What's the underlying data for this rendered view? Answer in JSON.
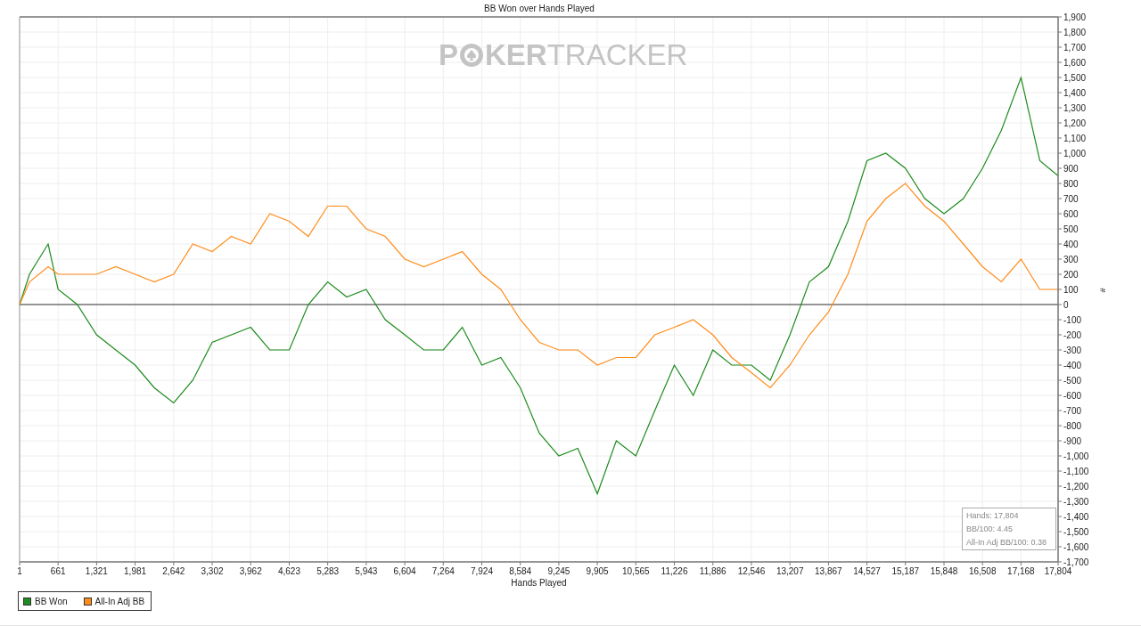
{
  "logo": {
    "before_chip": "P",
    "after_chip": "KER",
    "second_word": "TRACKER"
  },
  "chart_data": {
    "type": "line",
    "title": "BB Won over Hands Played",
    "xlabel": "Hands Played",
    "ylabel": "#",
    "x": [
      1,
      170,
      490,
      661,
      990,
      1321,
      1650,
      1981,
      2310,
      2642,
      2970,
      3302,
      3630,
      3962,
      4290,
      4623,
      4950,
      5283,
      5610,
      5943,
      6270,
      6604,
      6930,
      7264,
      7590,
      7924,
      8250,
      8584,
      8910,
      9245,
      9570,
      9905,
      10230,
      10565,
      10890,
      11226,
      11550,
      11886,
      12210,
      12546,
      12870,
      13207,
      13540,
      13867,
      14200,
      14527,
      14850,
      15187,
      15520,
      15848,
      16180,
      16508,
      16830,
      17168,
      17490,
      17804
    ],
    "series": [
      {
        "name": "BB Won",
        "color": "#1e8c1e",
        "values": [
          0,
          200,
          400,
          100,
          0,
          -200,
          -300,
          -400,
          -550,
          -650,
          -500,
          -250,
          -200,
          -150,
          -300,
          -300,
          0,
          150,
          50,
          100,
          -100,
          -200,
          -300,
          -300,
          -150,
          -400,
          -350,
          -550,
          -850,
          -1000,
          -950,
          -1250,
          -900,
          -1000,
          -700,
          -400,
          -600,
          -300,
          -400,
          -400,
          -500,
          -200,
          150,
          250,
          550,
          950,
          1000,
          900,
          700,
          600,
          700,
          900,
          1150,
          1500,
          950,
          850
        ]
      },
      {
        "name": "All-In Adj BB",
        "color": "#ff8c1a",
        "values": [
          0,
          150,
          250,
          200,
          200,
          200,
          250,
          200,
          150,
          200,
          400,
          350,
          450,
          400,
          600,
          550,
          450,
          650,
          650,
          500,
          450,
          300,
          250,
          300,
          350,
          200,
          100,
          -100,
          -250,
          -300,
          -300,
          -400,
          -350,
          -350,
          -200,
          -150,
          -100,
          -200,
          -350,
          -450,
          -550,
          -400,
          -200,
          -50,
          200,
          550,
          700,
          800,
          650,
          550,
          400,
          250,
          150,
          300,
          100,
          100
        ]
      }
    ],
    "grid": true,
    "xlim": [
      1,
      17804
    ],
    "ylim": [
      -1700,
      1900
    ],
    "xticks": [
      {
        "value": 1,
        "label": "1"
      },
      {
        "value": 661,
        "label": "661"
      },
      {
        "value": 1321,
        "label": "1,321"
      },
      {
        "value": 1981,
        "label": "1,981"
      },
      {
        "value": 2642,
        "label": "2,642"
      },
      {
        "value": 3302,
        "label": "3,302"
      },
      {
        "value": 3962,
        "label": "3,962"
      },
      {
        "value": 4623,
        "label": "4,623"
      },
      {
        "value": 5283,
        "label": "5,283"
      },
      {
        "value": 5943,
        "label": "5,943"
      },
      {
        "value": 6604,
        "label": "6,604"
      },
      {
        "value": 7264,
        "label": "7,264"
      },
      {
        "value": 7924,
        "label": "7,924"
      },
      {
        "value": 8584,
        "label": "8,584"
      },
      {
        "value": 9245,
        "label": "9,245"
      },
      {
        "value": 9905,
        "label": "9,905"
      },
      {
        "value": 10565,
        "label": "10,565"
      },
      {
        "value": 11226,
        "label": "11,226"
      },
      {
        "value": 11886,
        "label": "11,886"
      },
      {
        "value": 12546,
        "label": "12,546"
      },
      {
        "value": 13207,
        "label": "13,207"
      },
      {
        "value": 13867,
        "label": "13,867"
      },
      {
        "value": 14527,
        "label": "14,527"
      },
      {
        "value": 15187,
        "label": "15,187"
      },
      {
        "value": 15848,
        "label": "15,848"
      },
      {
        "value": 16508,
        "label": "16,508"
      },
      {
        "value": 17168,
        "label": "17,168"
      },
      {
        "value": 17804,
        "label": "17,804"
      }
    ],
    "yticks": [
      {
        "value": 1900,
        "label": "1,900"
      },
      {
        "value": 1800,
        "label": "1,800"
      },
      {
        "value": 1700,
        "label": "1,700"
      },
      {
        "value": 1600,
        "label": "1,600"
      },
      {
        "value": 1500,
        "label": "1,500"
      },
      {
        "value": 1400,
        "label": "1,400"
      },
      {
        "value": 1300,
        "label": "1,300"
      },
      {
        "value": 1200,
        "label": "1,200"
      },
      {
        "value": 1100,
        "label": "1,100"
      },
      {
        "value": 1000,
        "label": "1,000"
      },
      {
        "value": 900,
        "label": "900"
      },
      {
        "value": 800,
        "label": "800"
      },
      {
        "value": 700,
        "label": "700"
      },
      {
        "value": 600,
        "label": "600"
      },
      {
        "value": 500,
        "label": "500"
      },
      {
        "value": 400,
        "label": "400"
      },
      {
        "value": 300,
        "label": "300"
      },
      {
        "value": 200,
        "label": "200"
      },
      {
        "value": 100,
        "label": "100"
      },
      {
        "value": 0,
        "label": "0"
      },
      {
        "value": -100,
        "label": "-100"
      },
      {
        "value": -200,
        "label": "-200"
      },
      {
        "value": -300,
        "label": "-300"
      },
      {
        "value": -400,
        "label": "-400"
      },
      {
        "value": -500,
        "label": "-500"
      },
      {
        "value": -600,
        "label": "-600"
      },
      {
        "value": -700,
        "label": "-700"
      },
      {
        "value": -800,
        "label": "-800"
      },
      {
        "value": -900,
        "label": "-900"
      },
      {
        "value": -1000,
        "label": "-1,000"
      },
      {
        "value": -1100,
        "label": "-1,100"
      },
      {
        "value": -1200,
        "label": "-1,200"
      },
      {
        "value": -1300,
        "label": "-1,300"
      },
      {
        "value": -1400,
        "label": "-1,400"
      },
      {
        "value": -1500,
        "label": "-1,500"
      },
      {
        "value": -1600,
        "label": "-1,600"
      },
      {
        "value": -1700,
        "label": "-1,700"
      }
    ]
  },
  "summary": [
    "Hands: 17,804",
    "BB/100: 4.45",
    "All-In Adj BB/100: 0.38"
  ]
}
